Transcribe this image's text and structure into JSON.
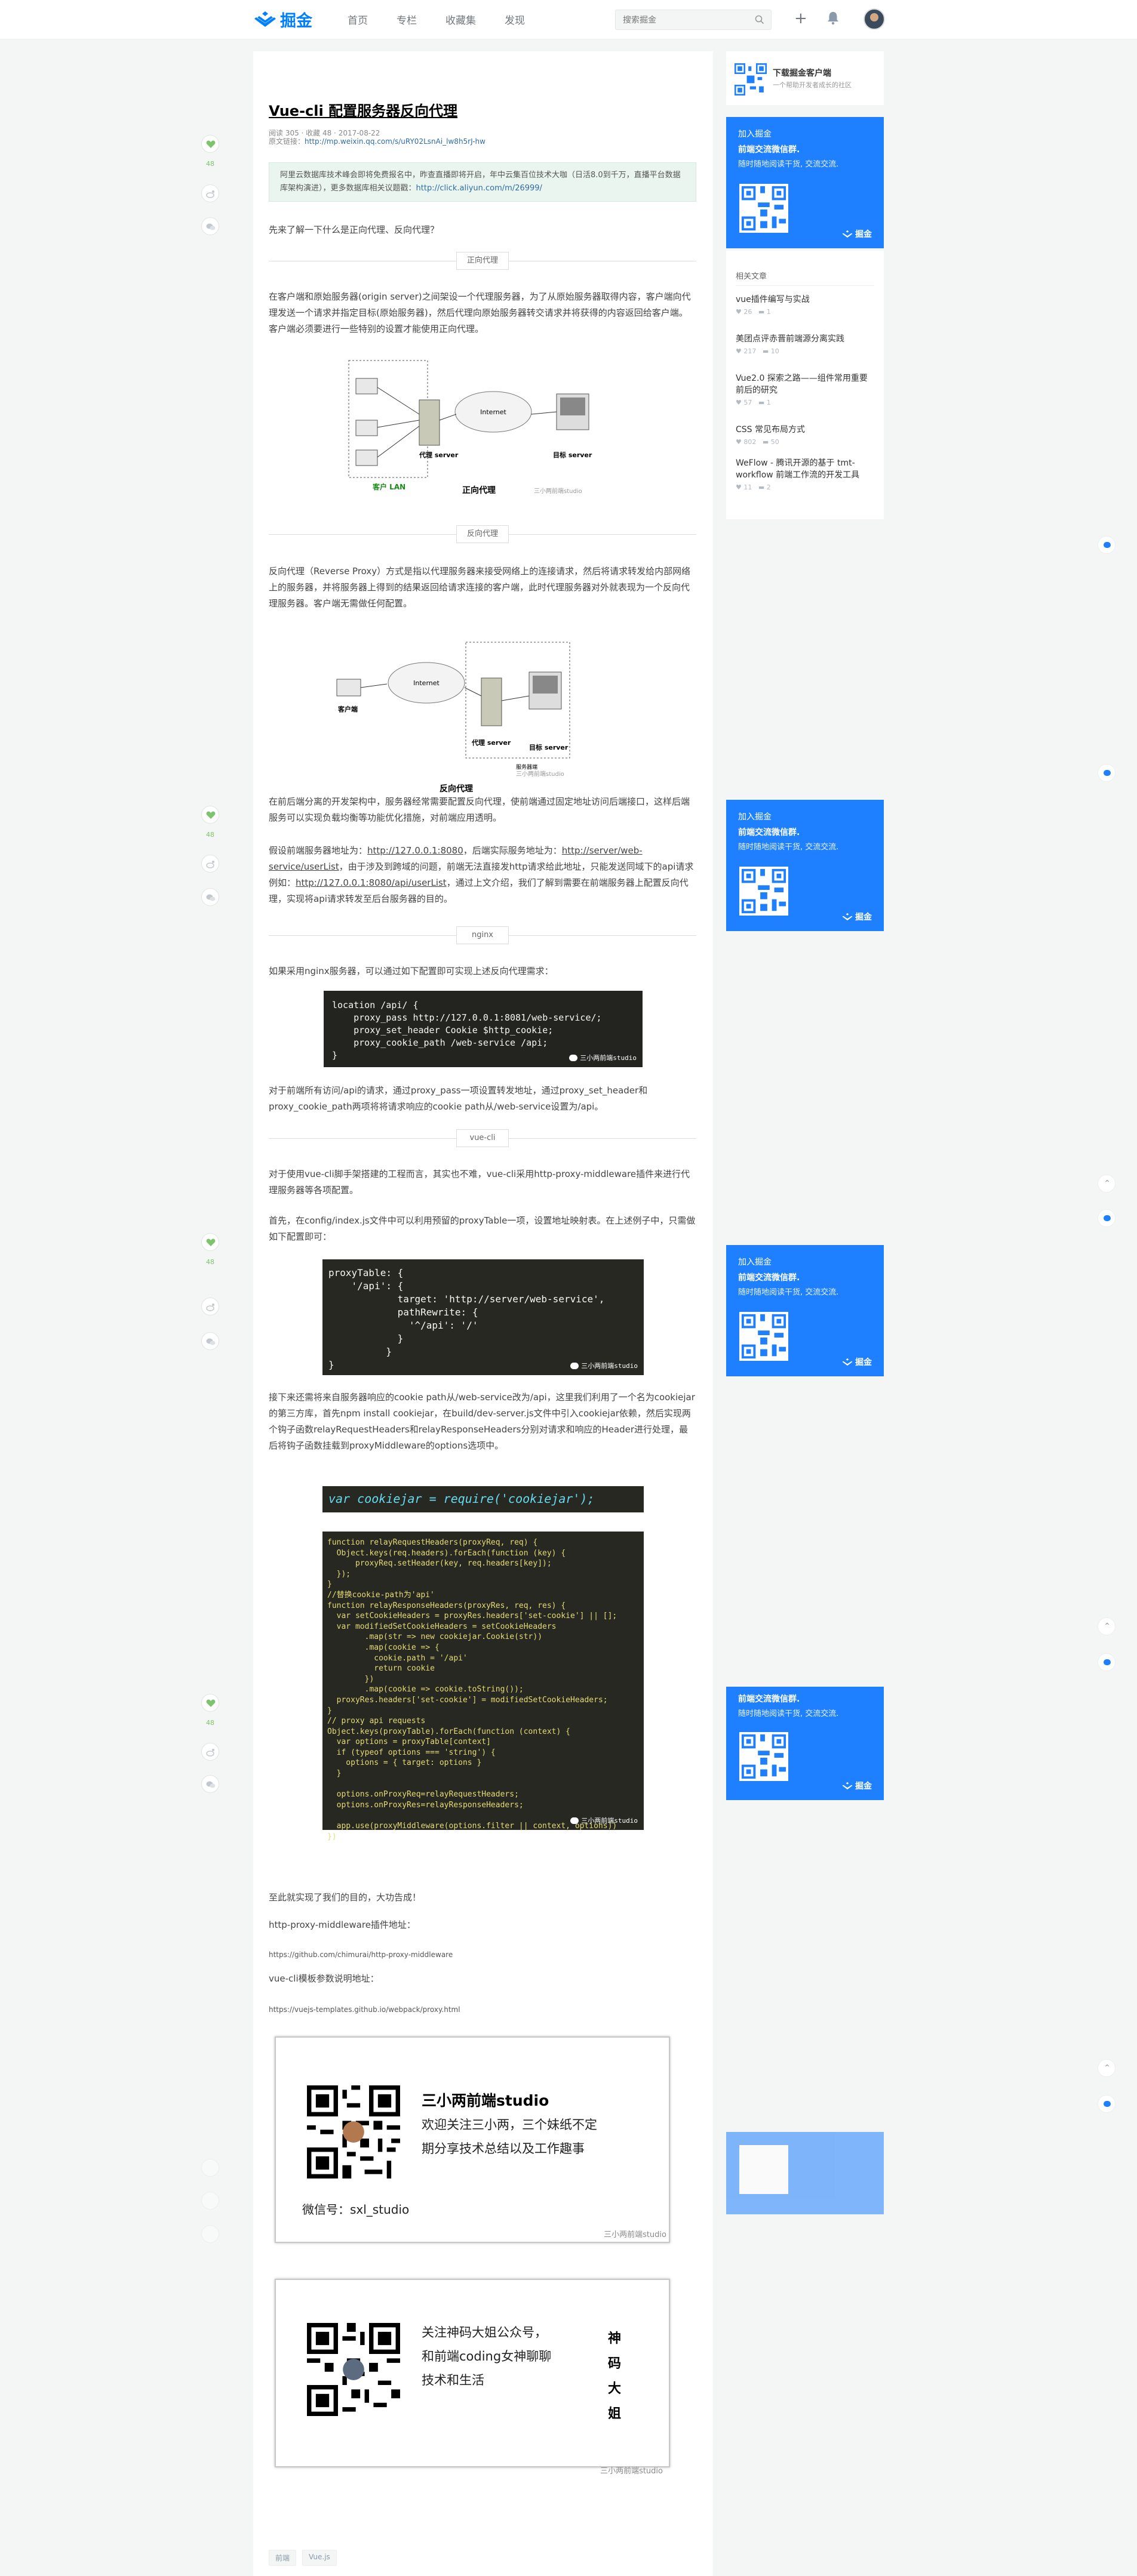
{
  "header": {
    "brand": "掘金",
    "nav": [
      "首页",
      "专栏",
      "收藏集",
      "发现"
    ],
    "search_placeholder": "搜索掘金",
    "plus": "+"
  },
  "article": {
    "title": "Vue-cli 配置服务器反向代理",
    "meta_line": "阅读 305 · 收藏 48 · 2017-08-22",
    "source_label": "原文链接：",
    "source_url": "http://mp.weixin.qq.com/s/uRY02LsnAi_lw8h5rJ-hw",
    "notice_text": "阿里云数据库技术峰会即将免费报名中，昨查直播即将开启，年中云集百位技术大咖（日活8.0到千万，直播平台数据库架构演进），更多数据库相关议题戳：",
    "notice_link": "http://click.aliyun.com/m/26999/",
    "intro": "先来了解一下什么是正向代理、反向代理？",
    "sec_forward": "正向代理",
    "para_forward": "在客户端和原始服务器(origin server)之间架设一个代理服务器，为了从原始服务器取得内容，客户端向代理发送一个请求并指定目标(原始服务器)，然后代理向原始服务器转交请求并将获得的内容返回给客户端。客户端必须要进行一些特别的设置才能使用正向代理。",
    "fig1": {
      "internet": "Internet",
      "proxy": "代理 server",
      "target": "目标 server",
      "client": "客户 LAN",
      "caption": "正向代理",
      "wm": "三小两前端studio"
    },
    "sec_reverse": "反向代理",
    "para_reverse": "反向代理（Reverse Proxy）方式是指以代理服务器来接受网络上的连接请求，然后将请求转发给内部网络上的服务器，并将服务器上得到的结果返回给请求连接的客户端，此时代理服务器对外就表现为一个反向代理服务器。客户端无需做任何配置。",
    "fig2": {
      "internet": "Internet",
      "client": "客户端",
      "proxy": "代理 server",
      "target": "目标 server",
      "group": "服务器端",
      "caption": "反向代理",
      "wm": "三小两前端studio"
    },
    "para_dev1": "在前后端分离的开发架构中，服务器经常需要配置反向代理，使前端通过固定地址访问后端接口，这样后端服务可以实现负载均衡等功能优化措施，对前端应用透明。",
    "para_dev2a": "假设前端服务器地址为：",
    "para_dev2_url1": "http://127.0.0.1:8080",
    "para_dev2b": "，后端实际服务地址为：",
    "para_dev2_url2": "http://server/web-service/userList",
    "para_dev2c": "，由于涉及到跨域的问题，前端无法直接发http请求给此地址，只能发送同域下的api请求例如：",
    "para_dev2_url3": "http://127.0.0.1:8080/api/userList",
    "para_dev2d": "，通过上文介绍，我们了解到需要在前端服务器上配置反向代理，实现将api请求转发至后台服务器的目的。",
    "sec_nginx": "nginx",
    "para_nginx": "如果采用nginx服务器，可以通过如下配置即可实现上述反向代理需求：",
    "code_nginx": "location /api/ {\n    proxy_pass http://127.0.0.1:8081/web-service/;\n    proxy_set_header Cookie $http_cookie;\n    proxy_cookie_path /web-service /api;\n}",
    "wm_code": "三小两前端studio",
    "para_nginx2": "对于前端所有访问/api的请求，通过proxy_pass一项设置转发地址，通过proxy_set_header和proxy_cookie_path两项将将请求响应的cookie path从/web-service设置为/api。",
    "sec_vuecli": "vue-cli",
    "para_vuecli1": "对于使用vue-cli脚手架搭建的工程而言，其实也不难，vue-cli采用http-proxy-middleware插件来进行代理服务器等各项配置。",
    "para_vuecli2": "首先，在config/index.js文件中可以利用预留的proxyTable一项，设置地址映射表。在上述例子中，只需做如下配置即可：",
    "code_proxy": "proxyTable: {\n    '/api': {\n            target: 'http://server/web-service',\n            pathRewrite: {\n              '^/api': '/'\n            }\n          }\n}",
    "para_vuecli3": "接下来还需将来自服务器响应的cookie path从/web-service改为/api，这里我们利用了一个名为cookiejar的第三方库，首先npm install cookiejar，在build/dev-server.js文件中引入cookiejar依赖，然后实现两个钩子函数relayRequestHeaders和relayResponseHeaders分别对请求和响应的Header进行处理，最后将钩子函数挂载到proxyMiddleware的options选项中。",
    "code_require": "var cookiejar = require('cookiejar');",
    "code_main": "function relayRequestHeaders(proxyReq, req) {\n  Object.keys(req.headers).forEach(function (key) {\n      proxyReq.setHeader(key, req.headers[key]);\n  });\n}\n//替换cookie-path为'api'\nfunction relayResponseHeaders(proxyRes, req, res) {\n  var setCookieHeaders = proxyRes.headers['set-cookie'] || [];\n  var modifiedSetCookieHeaders = setCookieHeaders\n        .map(str => new cookiejar.Cookie(str))\n        .map(cookie => {\n          cookie.path = '/api'\n          return cookie\n        })\n        .map(cookie => cookie.toString());\n  proxyRes.headers['set-cookie'] = modifiedSetCookieHeaders;\n}\n// proxy api requests\nObject.keys(proxyTable).forEach(function (context) {\n  var options = proxyTable[context]\n  if (typeof options === 'string') {\n    options = { target: options }\n  }\n\n  options.onProxyReq=relayRequestHeaders;\n  options.onProxyRes=relayResponseHeaders;\n\n  app.use(proxyMiddleware(options.filter || context, options))\n})",
    "para_done": "至此就实现了我们的目的，大功告成！",
    "plugin_label": "http-proxy-middleware插件地址：",
    "plugin_url": "https://github.com/chimurai/http-proxy-middleware",
    "doc_label": "vue-cli模板参数说明地址：",
    "doc_url": "https://vuejs-templates.github.io/webpack/proxy.html",
    "card1": {
      "name": "三小两前端studio",
      "desc1": "欢迎关注三小两，三个妹纸不定",
      "desc2": "期分享技术总结以及工作趣事",
      "wechat": "微信号：sxl_studio",
      "wm": "三小两前端studio"
    },
    "card2": {
      "line1": "关注神码大姐公众号，",
      "line2": "和前端coding女神聊聊",
      "line3": "技术和生活",
      "vert": [
        "神",
        "码",
        "大",
        "姐"
      ],
      "wm": "三小两前端studio"
    },
    "tags": [
      "前端",
      "Vue.js"
    ]
  },
  "side_actions": [
    {
      "likes": "48"
    },
    {
      "likes": "48"
    },
    {
      "likes": "48"
    },
    {
      "likes": "48"
    },
    {
      "likes": ""
    }
  ],
  "sidebar": {
    "download_title": "下载掘金客户端",
    "download_sub": "一个帮助开发者成长的社区",
    "ad": {
      "top": "加入掘金",
      "headline": "前端交流微信群.",
      "sub": "随时随地阅读干货, 交流交流.",
      "brand": "掘金"
    },
    "related_title": "相关文章",
    "related": [
      {
        "title": "vue插件编写与实战",
        "likes": "26",
        "comments": "1"
      },
      {
        "title": "美团点评赤晋前端源分离实践",
        "likes": "217",
        "comments": "10"
      },
      {
        "title": "Vue2.0 探索之路——组件常用重要前后的研究",
        "likes": "57",
        "comments": "1"
      },
      {
        "title": "CSS 常见布局方式",
        "likes": "802",
        "comments": "50"
      },
      {
        "title": "WeFlow - 腾讯开源的基于 tmt-workflow 前端工作流的开发工具",
        "likes": "11",
        "comments": "2"
      }
    ]
  },
  "colors": {
    "accent": "#1e80ff",
    "brand": "#007fff",
    "like": "#7ec46c"
  }
}
